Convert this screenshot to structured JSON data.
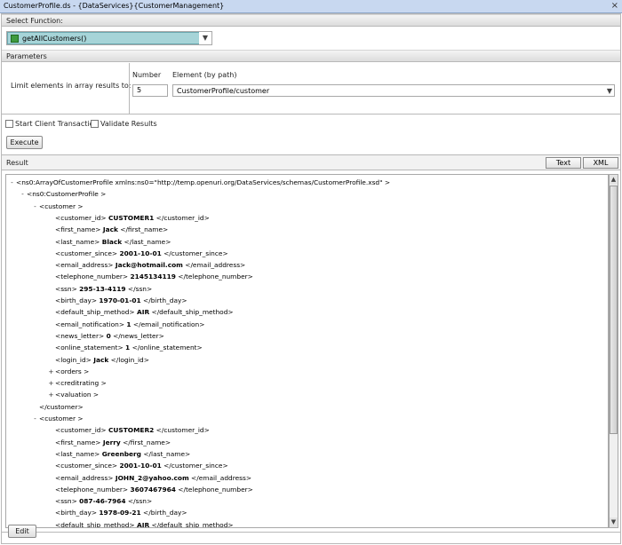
{
  "window": {
    "title": "CustomerProfile.ds - {DataServices}{CustomerManagement}"
  },
  "select_function": {
    "header": "Select Function:",
    "value": "getAllCustomers()"
  },
  "parameters": {
    "header": "Parameters",
    "limit_label": "Limit elements in array results to:",
    "number_header": "Number",
    "element_header": "Element (by path)",
    "number_value": "5",
    "element_value": "CustomerProfile/customer"
  },
  "options": {
    "client_transaction": "Start Client Transaction",
    "validate_results": "Validate Results"
  },
  "buttons": {
    "execute": "Execute",
    "edit": "Edit",
    "text": "Text",
    "xml": "XML"
  },
  "result": {
    "label": "Result"
  },
  "colors": {
    "title_bar": "#c8d8f0",
    "function_fill": "#a6d4d8",
    "function_icon": "#3f9a3f"
  },
  "icons": {
    "function": "function-icon",
    "dropdown": "chevron-down-icon",
    "scroll_up": "arrow-up-icon",
    "scroll_down": "arrow-down-icon"
  },
  "tree": [
    {
      "exp": "-",
      "indent": 0,
      "pre": "<ns0:ArrayOfCustomerProfile xmlns:ns0=\"http://temp.openuri.org/DataServices/schemas/CustomerProfile.xsd\" >",
      "val": "",
      "post": ""
    },
    {
      "exp": "-",
      "indent": 1,
      "pre": "<ns0:CustomerProfile >",
      "val": "",
      "post": ""
    },
    {
      "exp": "-",
      "indent": 2,
      "pre": "<customer >",
      "val": "",
      "post": ""
    },
    {
      "exp": "",
      "indent": 3,
      "pre": "<customer_id>",
      "val": "CUSTOMER1",
      "post": "</customer_id>"
    },
    {
      "exp": "",
      "indent": 3,
      "pre": "<first_name>",
      "val": "Jack",
      "post": "</first_name>"
    },
    {
      "exp": "",
      "indent": 3,
      "pre": "<last_name>",
      "val": "Black",
      "post": "</last_name>"
    },
    {
      "exp": "",
      "indent": 3,
      "pre": "<customer_since>",
      "val": "2001-10-01",
      "post": "</customer_since>"
    },
    {
      "exp": "",
      "indent": 3,
      "pre": "<email_address>",
      "val": "Jack@hotmail.com",
      "post": "</email_address>"
    },
    {
      "exp": "",
      "indent": 3,
      "pre": "<telephone_number>",
      "val": "2145134119",
      "post": "</telephone_number>"
    },
    {
      "exp": "",
      "indent": 3,
      "pre": "<ssn>",
      "val": "295-13-4119",
      "post": "</ssn>"
    },
    {
      "exp": "",
      "indent": 3,
      "pre": "<birth_day>",
      "val": "1970-01-01",
      "post": "</birth_day>"
    },
    {
      "exp": "",
      "indent": 3,
      "pre": "<default_ship_method>",
      "val": "AIR",
      "post": "</default_ship_method>"
    },
    {
      "exp": "",
      "indent": 3,
      "pre": "<email_notification>",
      "val": "1",
      "post": "</email_notification>"
    },
    {
      "exp": "",
      "indent": 3,
      "pre": "<news_letter>",
      "val": "0",
      "post": "</news_letter>"
    },
    {
      "exp": "",
      "indent": 3,
      "pre": "<online_statement>",
      "val": "1",
      "post": "</online_statement>"
    },
    {
      "exp": "",
      "indent": 3,
      "pre": "<login_id>",
      "val": "Jack",
      "post": "</login_id>"
    },
    {
      "exp": "+",
      "indent": 3,
      "pre": "<orders >",
      "val": "",
      "post": ""
    },
    {
      "exp": "+",
      "indent": 3,
      "pre": "<creditrating >",
      "val": "",
      "post": ""
    },
    {
      "exp": "+",
      "indent": 3,
      "pre": "<valuation >",
      "val": "",
      "post": ""
    },
    {
      "exp": "",
      "indent": 2,
      "pre": "</customer>",
      "val": "",
      "post": ""
    },
    {
      "exp": "-",
      "indent": 2,
      "pre": "<customer >",
      "val": "",
      "post": ""
    },
    {
      "exp": "",
      "indent": 3,
      "pre": "<customer_id>",
      "val": "CUSTOMER2",
      "post": "</customer_id>"
    },
    {
      "exp": "",
      "indent": 3,
      "pre": "<first_name>",
      "val": "Jerry",
      "post": "</first_name>"
    },
    {
      "exp": "",
      "indent": 3,
      "pre": "<last_name>",
      "val": "Greenberg",
      "post": "</last_name>"
    },
    {
      "exp": "",
      "indent": 3,
      "pre": "<customer_since>",
      "val": "2001-10-01",
      "post": "</customer_since>"
    },
    {
      "exp": "",
      "indent": 3,
      "pre": "<email_address>",
      "val": "JOHN_2@yahoo.com",
      "post": "</email_address>"
    },
    {
      "exp": "",
      "indent": 3,
      "pre": "<telephone_number>",
      "val": "3607467964",
      "post": "</telephone_number>"
    },
    {
      "exp": "",
      "indent": 3,
      "pre": "<ssn>",
      "val": "087-46-7964",
      "post": "</ssn>"
    },
    {
      "exp": "",
      "indent": 3,
      "pre": "<birth_day>",
      "val": "1978-09-21",
      "post": "</birth_day>"
    },
    {
      "exp": "",
      "indent": 3,
      "pre": "<default_ship_method>",
      "val": "AIR",
      "post": "</default_ship_method>"
    }
  ]
}
